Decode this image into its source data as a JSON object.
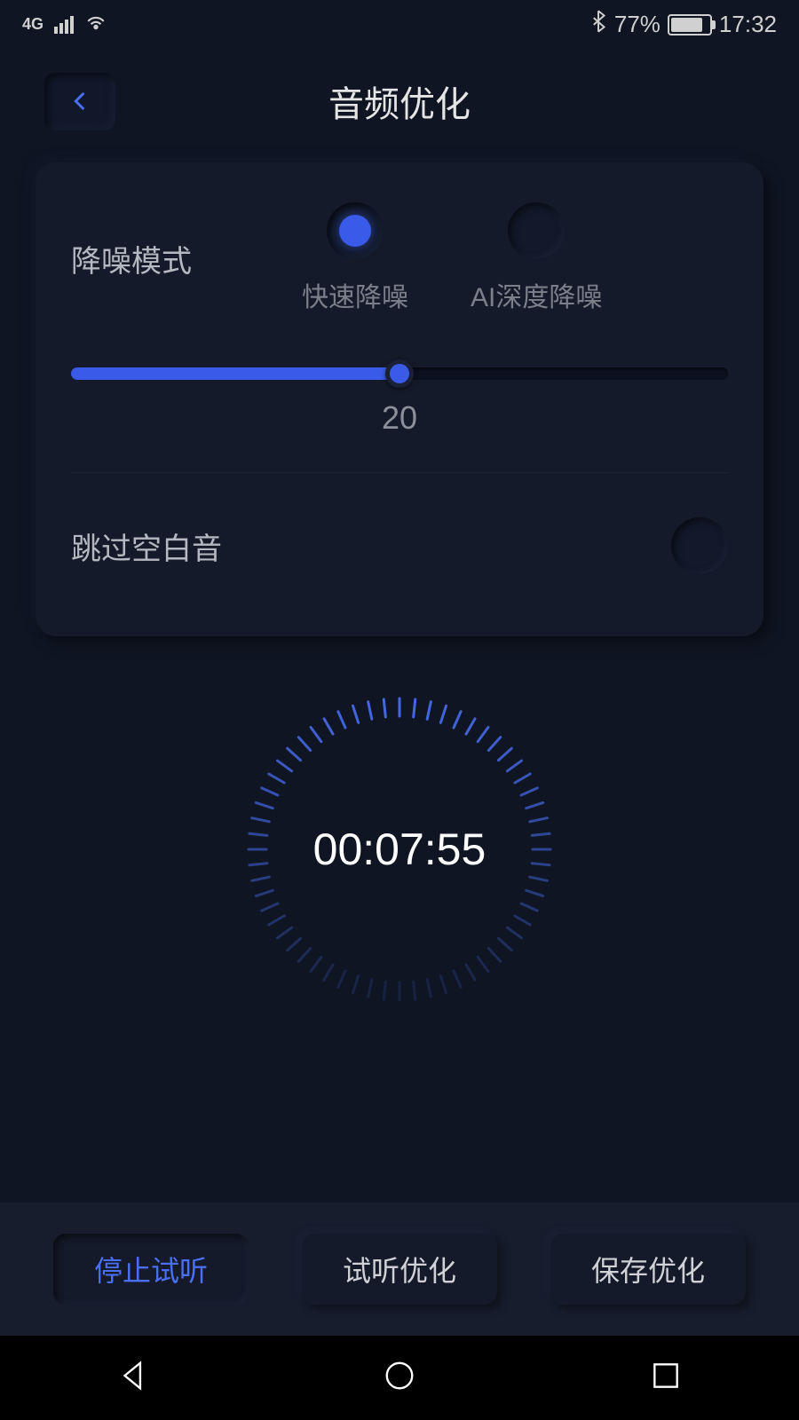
{
  "status": {
    "network": "4G",
    "bluetooth_icon": "bluetooth-icon",
    "battery_percent": "77%",
    "time": "17:32"
  },
  "header": {
    "title": "音频优化"
  },
  "noise": {
    "label": "降噪模式",
    "options": {
      "fast": "快速降噪",
      "ai": "AI深度降噪"
    },
    "slider_value": "20"
  },
  "skip_silence": {
    "label": "跳过空白音"
  },
  "timer": {
    "display": "00:07:55"
  },
  "actions": {
    "stop_preview": "停止试听",
    "preview": "试听优化",
    "save": "保存优化"
  }
}
